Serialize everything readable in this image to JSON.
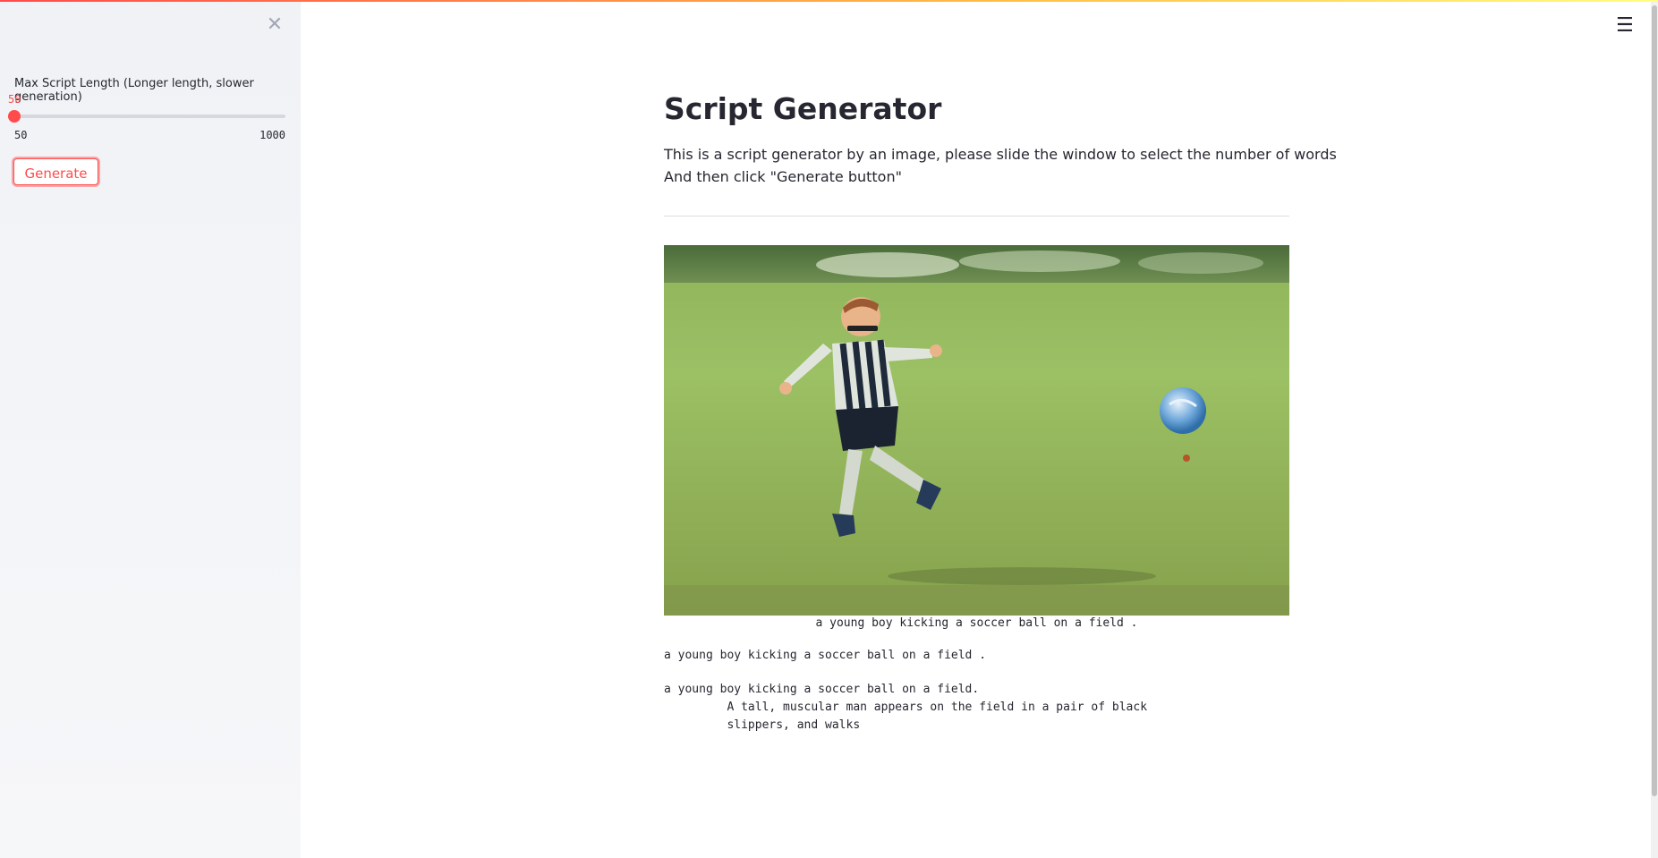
{
  "sidebar": {
    "close_icon": "close-icon",
    "slider": {
      "label": "Max Script Length (Longer length, slower generation)",
      "value": "50",
      "min": "50",
      "max": "1000",
      "fraction": 0.0
    },
    "generate_label": "Generate"
  },
  "menu_icon": "hamburger-menu-icon",
  "main": {
    "title": "Script Generator",
    "description_line1": "This is a script generator by an image, please slide the window to select the number of words",
    "description_line2": "And then click \"Generate button\"",
    "image_caption": "a young boy kicking a soccer ball on a field .",
    "output_caption": "a young boy kicking a soccer ball on a field .",
    "script_line1": "a young boy kicking a soccer ball on a field.",
    "script_line2": "         A tall, muscular man appears on the field in a pair of black",
    "script_line3": "         slippers, and walks"
  },
  "colors": {
    "accent": "#ff4b4b",
    "sidebar_bg": "#f0f2f6",
    "text": "#262730"
  }
}
